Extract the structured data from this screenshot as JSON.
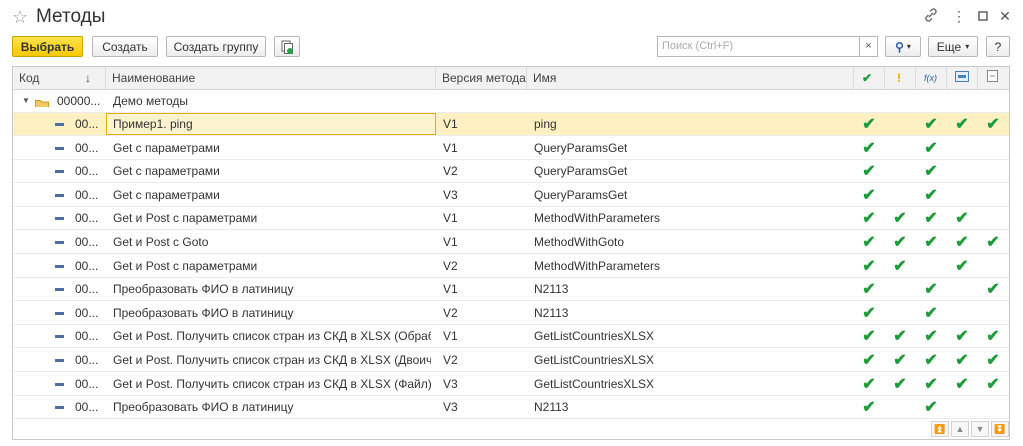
{
  "window": {
    "title": "Методы"
  },
  "toolbar": {
    "choose": "Выбрать",
    "create": "Создать",
    "create_group": "Создать группу",
    "search_placeholder": "Поиск (Ctrl+F)",
    "search_clear": "×",
    "more": "Еще",
    "help": "?"
  },
  "columns": {
    "code": "Код",
    "sort_arrow": "↓",
    "name": "Наименование",
    "version": "Версия метода",
    "ident": "Имя"
  },
  "group": {
    "code": "00000...",
    "name": "Демо методы"
  },
  "rows": [
    {
      "code": "00...",
      "name": "Пример1. ping",
      "version": "V1",
      "ident": "ping",
      "c1": "✔",
      "c2": "",
      "c3": "✔",
      "c4": "✔",
      "c5": "✔"
    },
    {
      "code": "00...",
      "name": "Get с параметрами",
      "version": "V1",
      "ident": "QueryParamsGet",
      "c1": "✔",
      "c2": "",
      "c3": "✔",
      "c4": "",
      "c5": ""
    },
    {
      "code": "00...",
      "name": "Get с параметрами",
      "version": "V2",
      "ident": "QueryParamsGet",
      "c1": "✔",
      "c2": "",
      "c3": "✔",
      "c4": "",
      "c5": ""
    },
    {
      "code": "00...",
      "name": "Get с параметрами",
      "version": "V3",
      "ident": "QueryParamsGet",
      "c1": "✔",
      "c2": "",
      "c3": "✔",
      "c4": "",
      "c5": ""
    },
    {
      "code": "00...",
      "name": "Get и Post с параметрами",
      "version": "V1",
      "ident": "MethodWithParameters",
      "c1": "✔",
      "c2": "✔",
      "c3": "✔",
      "c4": "✔",
      "c5": ""
    },
    {
      "code": "00...",
      "name": "Get и Post с Goto",
      "version": "V1",
      "ident": "MethodWithGoto",
      "c1": "✔",
      "c2": "✔",
      "c3": "✔",
      "c4": "✔",
      "c5": "✔"
    },
    {
      "code": "00...",
      "name": "Get и Post с параметрами",
      "version": "V2",
      "ident": "MethodWithParameters",
      "c1": "✔",
      "c2": "✔",
      "c3": "",
      "c4": "✔",
      "c5": ""
    },
    {
      "code": "00...",
      "name": "Преобразовать ФИО в латиницу",
      "version": "V1",
      "ident": "N2113",
      "c1": "✔",
      "c2": "",
      "c3": "✔",
      "c4": "",
      "c5": "✔"
    },
    {
      "code": "00...",
      "name": "Преобразовать ФИО в латиницу",
      "version": "V2",
      "ident": "N2113",
      "c1": "✔",
      "c2": "",
      "c3": "✔",
      "c4": "",
      "c5": ""
    },
    {
      "code": "00...",
      "name": "Get и Post. Получить список стран из СКД в XLSX (Обработ…",
      "version": "V1",
      "ident": "GetListCountriesXLSX",
      "c1": "✔",
      "c2": "✔",
      "c3": "✔",
      "c4": "✔",
      "c5": "✔"
    },
    {
      "code": "00...",
      "name": "Get и Post. Получить список стран из СКД в XLSX (Двоичны…",
      "version": "V2",
      "ident": "GetListCountriesXLSX",
      "c1": "✔",
      "c2": "✔",
      "c3": "✔",
      "c4": "✔",
      "c5": "✔"
    },
    {
      "code": "00...",
      "name": "Get и Post. Получить список стран из СКД в XLSX (Файл)",
      "version": "V3",
      "ident": "GetListCountriesXLSX",
      "c1": "✔",
      "c2": "✔",
      "c3": "✔",
      "c4": "✔",
      "c5": "✔"
    },
    {
      "code": "00...",
      "name": "Преобразовать ФИО в латиницу",
      "version": "V3",
      "ident": "N2113",
      "c1": "✔",
      "c2": "",
      "c3": "✔",
      "c4": "",
      "c5": ""
    }
  ],
  "colors": {
    "accent": "#f5c800",
    "selected_row": "#fdf0c2",
    "check": "#1e9b3a"
  }
}
